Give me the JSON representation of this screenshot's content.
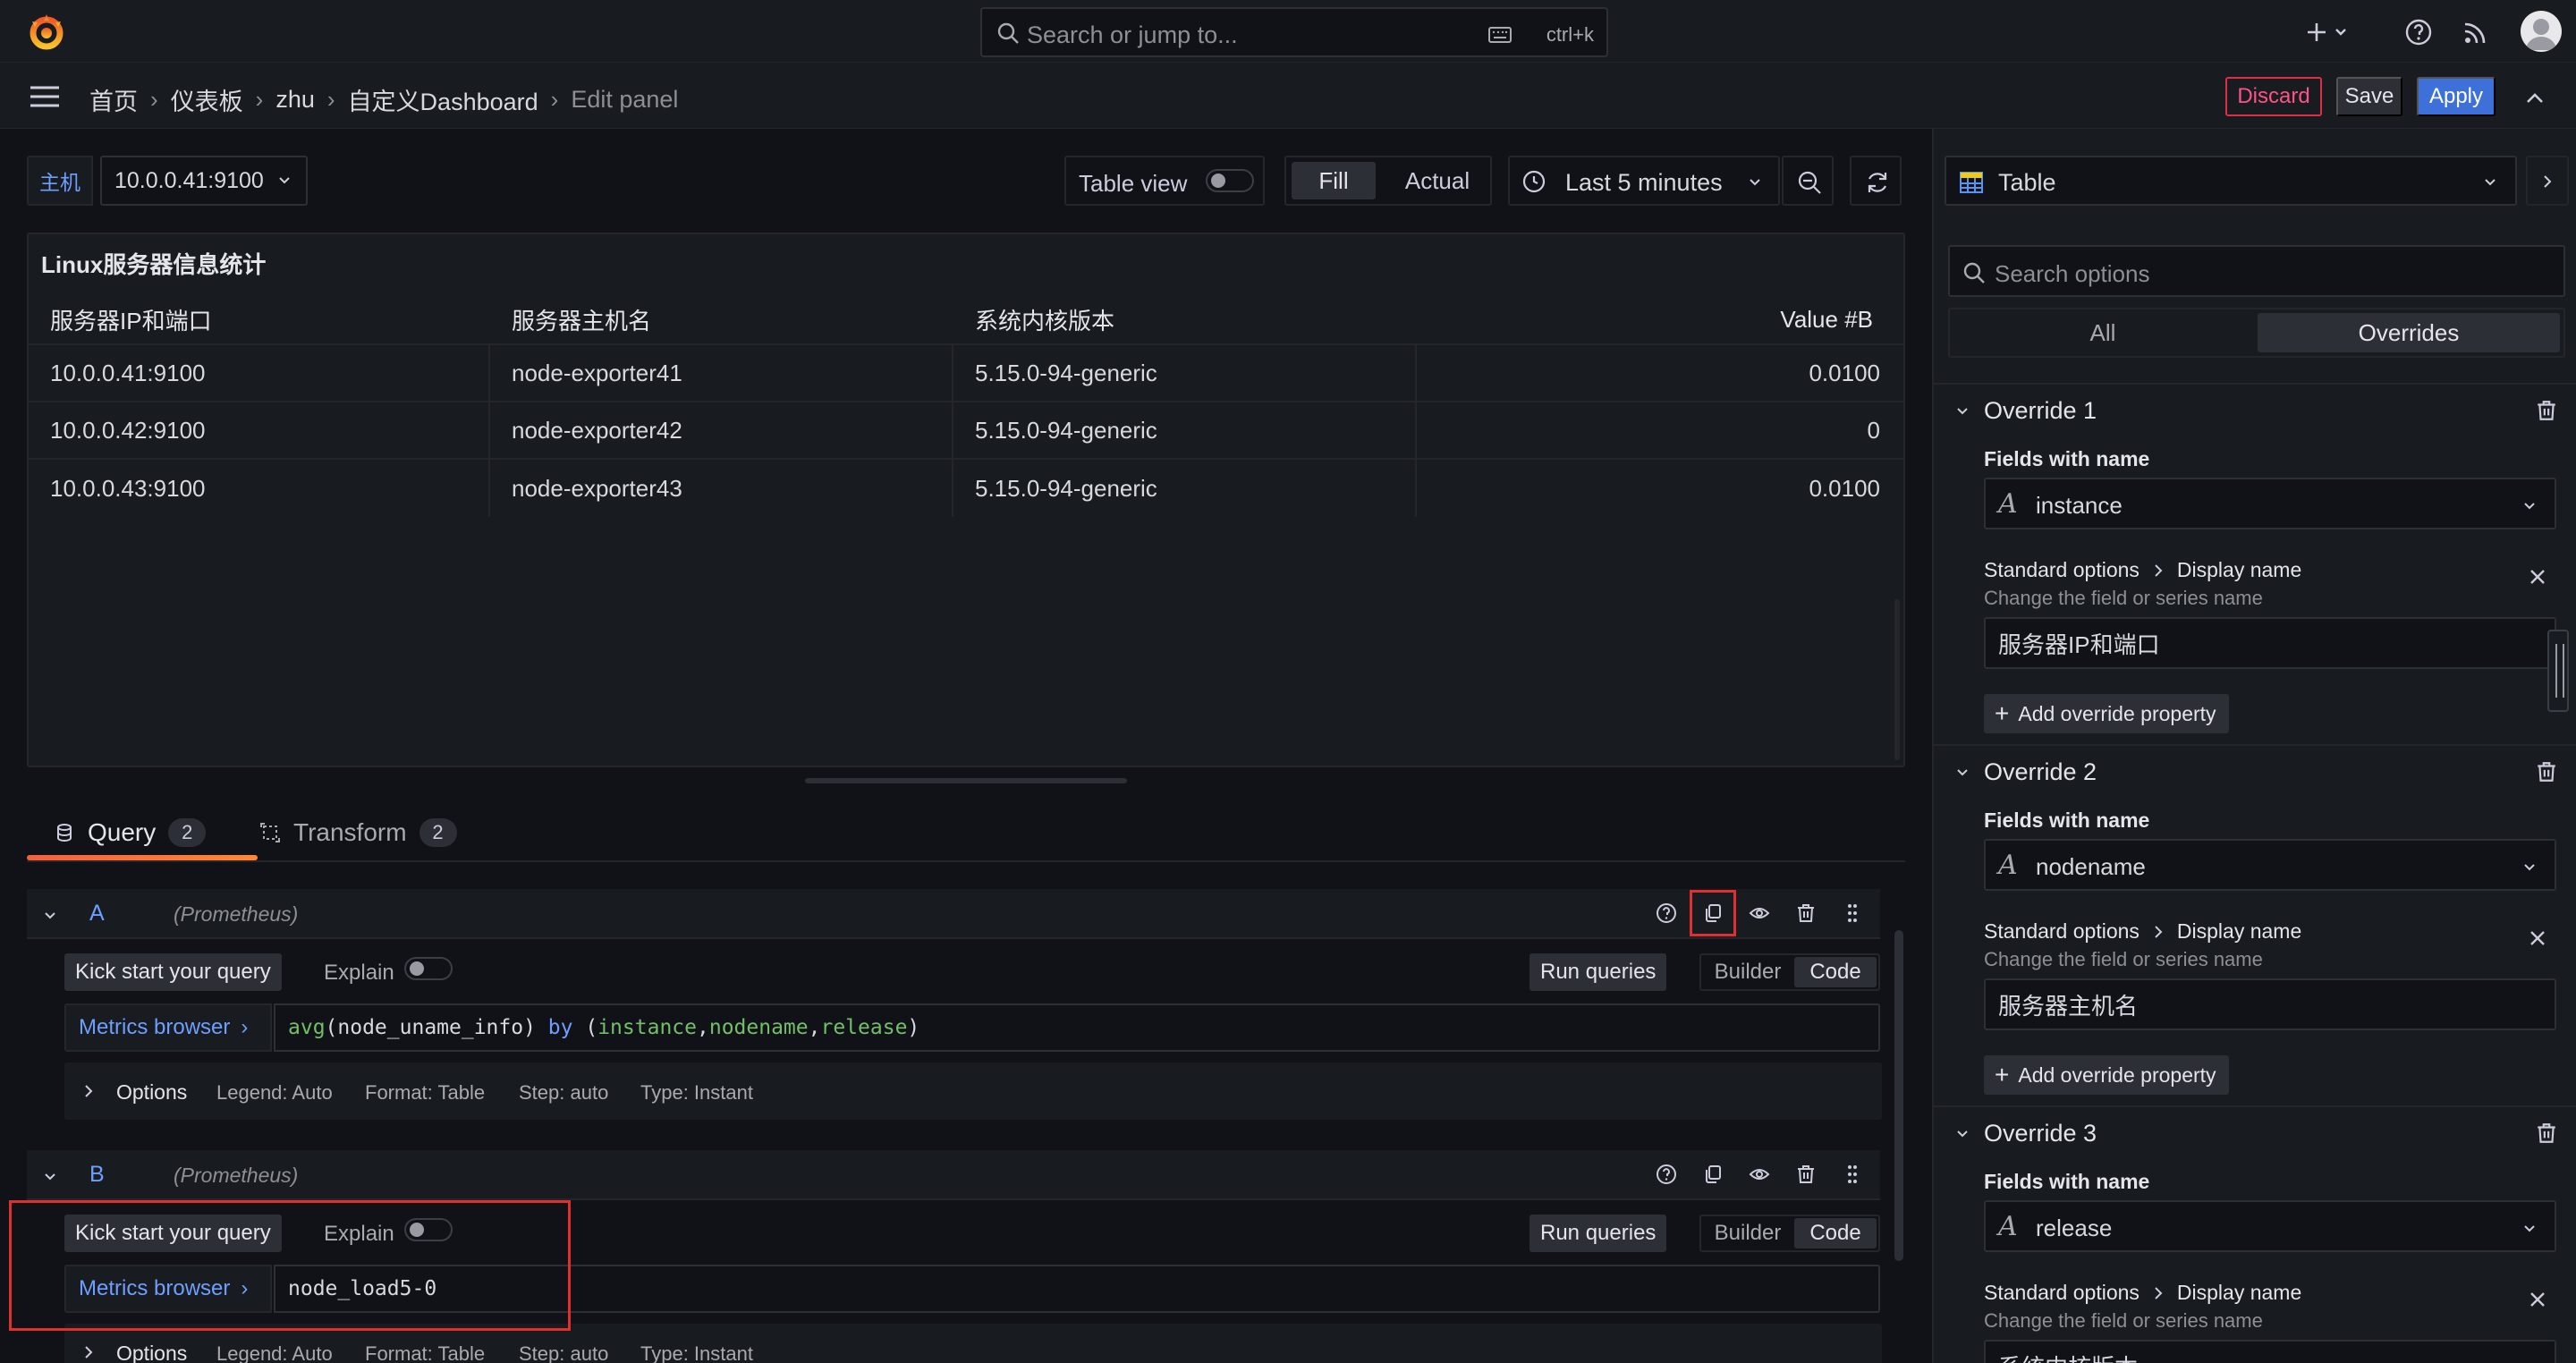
{
  "topbar": {
    "search_placeholder": "Search or jump to...",
    "search_shortcut": "ctrl+k"
  },
  "breadcrumb": {
    "items": [
      "首页",
      "仪表板",
      "zhu",
      "自定义Dashboard",
      "Edit panel"
    ]
  },
  "actions": {
    "discard": "Discard",
    "save": "Save",
    "apply": "Apply"
  },
  "variable": {
    "label": "主机",
    "value": "10.0.0.41:9100"
  },
  "toolbar": {
    "table_view": "Table view",
    "fill": "Fill",
    "actual": "Actual",
    "time_range": "Last 5 minutes"
  },
  "panel": {
    "title": "Linux服务器信息统计",
    "columns": [
      "服务器IP和端口",
      "服务器主机名",
      "系统内核版本",
      "Value #B"
    ],
    "rows": [
      [
        "10.0.0.41:9100",
        "node-exporter41",
        "5.15.0-94-generic",
        "0.0100"
      ],
      [
        "10.0.0.42:9100",
        "node-exporter42",
        "5.15.0-94-generic",
        "0"
      ],
      [
        "10.0.0.43:9100",
        "node-exporter43",
        "5.15.0-94-generic",
        "0.0100"
      ]
    ]
  },
  "tabs": {
    "query_label": "Query",
    "query_count": "2",
    "transform_label": "Transform",
    "transform_count": "2"
  },
  "queries": {
    "a": {
      "ref": "A",
      "datasource": "(Prometheus)",
      "kick_start": "Kick start your query",
      "explain": "Explain",
      "run": "Run queries",
      "builder": "Builder",
      "code": "Code",
      "metrics_browser": "Metrics browser",
      "expr_fn": "avg",
      "expr_mid": "(node_uname_info) ",
      "expr_kw": "by",
      "expr_sp": " (",
      "expr_l1": "instance",
      "expr_c1": ",",
      "expr_l2": "nodename",
      "expr_c2": ",",
      "expr_l3": "release",
      "expr_end": ")",
      "options": "Options",
      "legend": "Legend: Auto",
      "format": "Format: Table",
      "step": "Step: auto",
      "type": "Type: Instant"
    },
    "b": {
      "ref": "B",
      "datasource": "(Prometheus)",
      "kick_start": "Kick start your query",
      "explain": "Explain",
      "run": "Run queries",
      "builder": "Builder",
      "code": "Code",
      "metrics_browser": "Metrics browser",
      "expr": "node_load5-0",
      "options": "Options",
      "legend": "Legend: Auto",
      "format": "Format: Table",
      "step": "Step: auto",
      "type": "Type: Instant"
    }
  },
  "options_pane": {
    "visualization": "Table",
    "search_placeholder": "Search options",
    "all": "All",
    "overrides": "Overrides",
    "fields_with_name": "Fields with name",
    "standard_options": "Standard options",
    "display_name": "Display name",
    "prop_desc": "Change the field or series name",
    "add_property": "Add override property",
    "overrides_list": [
      {
        "title": "Override 1",
        "field": "instance",
        "display": "服务器IP和端口"
      },
      {
        "title": "Override 2",
        "field": "nodename",
        "display": "服务器主机名"
      },
      {
        "title": "Override 3",
        "field": "release",
        "display": "系统内核版本"
      }
    ]
  },
  "colors": {
    "accent_blue": "#3d71d9",
    "discard_red": "#e02f44",
    "highlight_red": "#e02f2f",
    "tab_orange": "#f55f3e"
  }
}
